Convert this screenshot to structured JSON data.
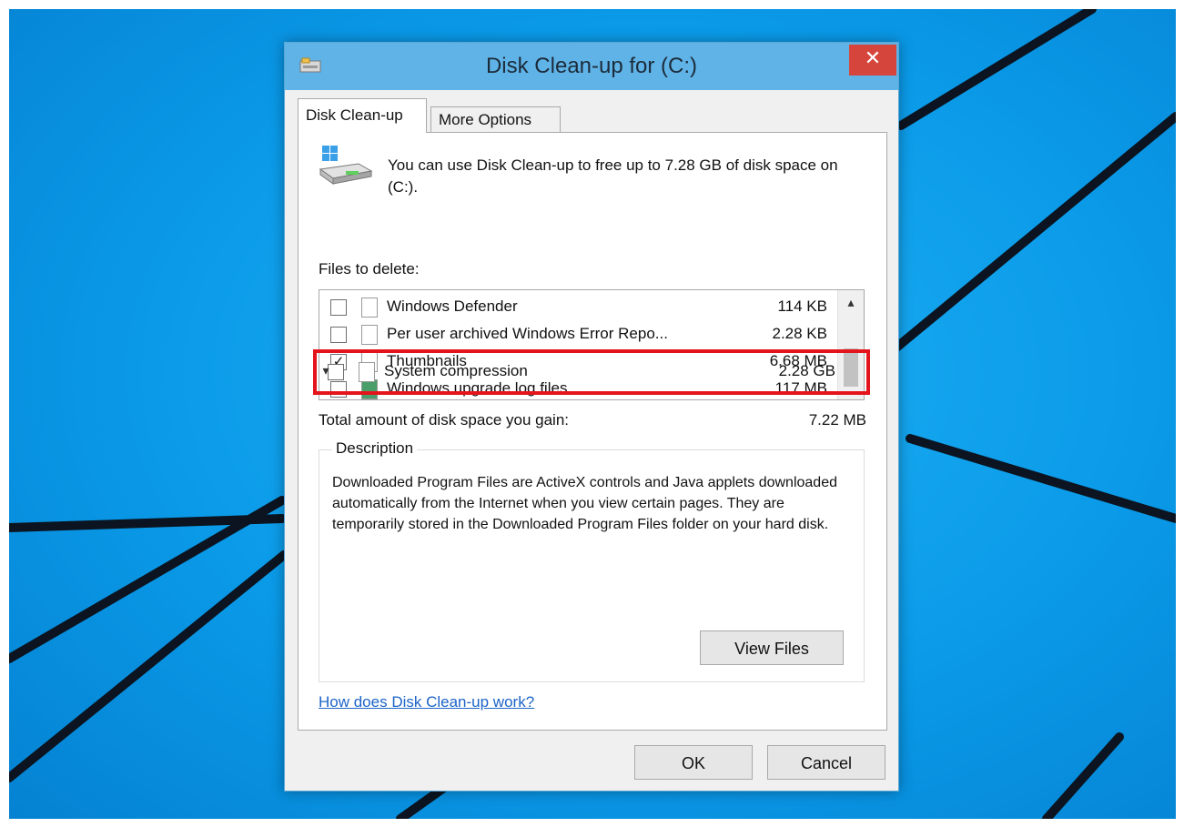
{
  "window": {
    "title": "Disk Clean-up for  (C:)",
    "close_glyph": "✕"
  },
  "tabs": [
    {
      "label": "Disk Clean-up",
      "active": true
    },
    {
      "label": "More Options",
      "active": false
    }
  ],
  "intro": "You can use Disk Clean-up to free up to 7.28 GB of disk space on  (C:).",
  "files_label": "Files to delete:",
  "files": [
    {
      "name": "Windows Defender",
      "size": "114 KB",
      "checked": false
    },
    {
      "name": "Per user archived Windows Error Repo...",
      "size": "2.28 KB",
      "checked": false
    },
    {
      "name": "Thumbnails",
      "size": "6.68 MB",
      "checked": true
    },
    {
      "name": "Windows upgrade log files",
      "size": "117 MB",
      "checked": false
    },
    {
      "name": "System compression",
      "size": "2.28 GB",
      "checked": false
    }
  ],
  "checkmark": "✓",
  "scroll": {
    "up": "▴",
    "down": "▾"
  },
  "gain": {
    "label": "Total amount of disk space you gain:",
    "value": "7.22 MB"
  },
  "description": {
    "legend": "Description",
    "text": "Downloaded Program Files are ActiveX controls and Java applets downloaded automatically from the Internet when you view certain pages. They are temporarily stored in the Downloaded Program Files folder on your hard disk."
  },
  "view_files_label": "View Files",
  "help_link": "How does Disk Clean-up work?",
  "ok_label": "OK",
  "cancel_label": "Cancel",
  "colors": {
    "desktop": "#0a9ae8",
    "titlebar": "#60b3e6",
    "close": "#d6453b",
    "highlight": "#e4141c",
    "link": "#1d64c8"
  },
  "icons": [
    "disk-cleanup-icon",
    "drive-icon",
    "close-icon",
    "file-icon",
    "checkbox-icon",
    "scroll-up-icon",
    "scroll-down-icon"
  ]
}
